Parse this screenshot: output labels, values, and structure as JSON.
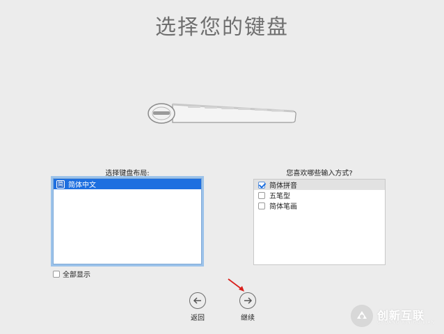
{
  "title": "选择您的键盘",
  "layout_panel": {
    "label": "选择键盘布局:",
    "items": [
      {
        "icon": "chinese-simplified-input-icon",
        "icon_glyph": "简",
        "label": "简体中文",
        "selected": true
      }
    ],
    "show_all": {
      "label": "全部显示",
      "checked": false
    }
  },
  "method_panel": {
    "label": "您喜欢哪些输入方式?",
    "items": [
      {
        "label": "简体拼音",
        "checked": true
      },
      {
        "label": "五笔型",
        "checked": false
      },
      {
        "label": "简体笔画",
        "checked": false
      }
    ]
  },
  "nav": {
    "back_label": "返回",
    "continue_label": "继续"
  },
  "watermark": {
    "text": "创新互联",
    "sub": "CHUANG XIN HU LIAN"
  },
  "colors": {
    "background": "#ececec",
    "selection": "#1d6fe0",
    "annotation_arrow": "#d9201c"
  }
}
